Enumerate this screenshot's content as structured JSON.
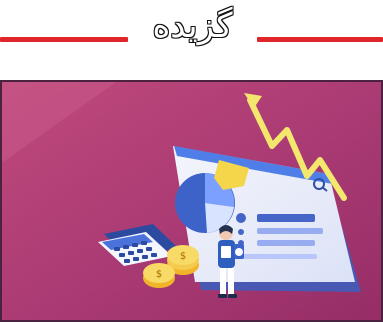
{
  "header": {
    "title": "گزیده"
  },
  "image": {
    "background_color": "#b33b73",
    "accent_colors": [
      "#e0262b",
      "#f2de43",
      "#2d5fb7",
      "#ffffff"
    ],
    "caption": ""
  }
}
